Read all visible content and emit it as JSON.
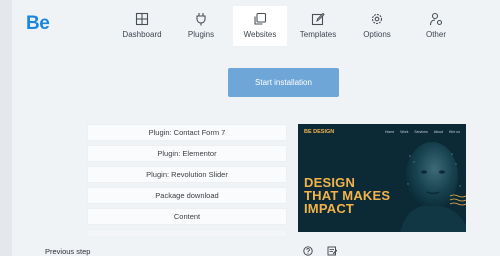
{
  "app": {
    "logo": "Be"
  },
  "nav": {
    "items": [
      {
        "label": "Dashboard",
        "icon": "grid-icon"
      },
      {
        "label": "Plugins",
        "icon": "plug-icon"
      },
      {
        "label": "Websites",
        "icon": "copy-icon",
        "active": true
      },
      {
        "label": "Templates",
        "icon": "edit-icon"
      },
      {
        "label": "Options",
        "icon": "gear-icon"
      },
      {
        "label": "Other",
        "icon": "user-settings-icon"
      }
    ]
  },
  "install": {
    "button_label": "Start installation"
  },
  "steps": [
    "Plugin: Contact Form 7",
    "Plugin: Elementor",
    "Plugin: Revolution Slider",
    "Package download",
    "Content"
  ],
  "preview": {
    "brand": "BE DESIGN",
    "menu": [
      "Home",
      "Work",
      "Services",
      "About",
      "Hire us"
    ],
    "headline_lines": [
      "DESIGN",
      "THAT MAKES",
      "IMPACT"
    ]
  },
  "footer": {
    "previous_step": "Previous step"
  },
  "colors": {
    "accent": "#1a86e0",
    "button": "#6fa6d8",
    "preview_bg": "#0b2a36",
    "preview_text": "#f3b34a"
  }
}
